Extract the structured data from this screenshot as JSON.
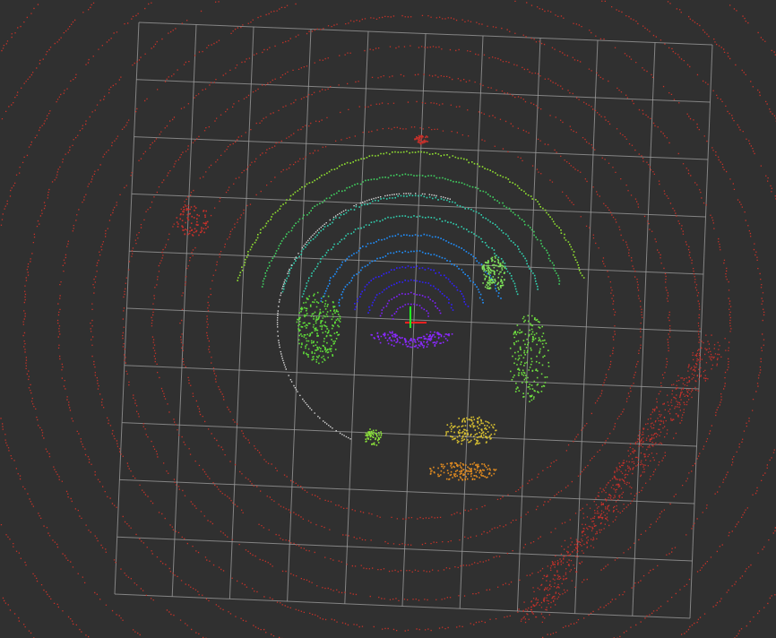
{
  "viewer": {
    "background_color": "#303030",
    "grid_color": "#a0a0a0",
    "grid_cells": 10,
    "axis_x_color": "#ff2020",
    "axis_y_color": "#20ff20",
    "far_point_color": "#c83228"
  },
  "point_cloud": {
    "color_map": "distance-rainbow",
    "near_colors": [
      "#8020ff",
      "#3020ff",
      "#2090ff",
      "#30d0b0",
      "#40d060",
      "#90e030",
      "#e0c020",
      "#e07020",
      "#c83228"
    ],
    "ring_count": 22,
    "obstacles": [
      {
        "id": "cluster-left-green",
        "color": "#5fdc3a"
      },
      {
        "id": "cluster-front-right-green",
        "color": "#7fe55a"
      },
      {
        "id": "cluster-right-green",
        "color": "#6fe040"
      },
      {
        "id": "cluster-bottom-yellow",
        "color": "#d8c030"
      },
      {
        "id": "cluster-bottom-orange",
        "color": "#e08a20"
      },
      {
        "id": "cluster-bottom-green",
        "color": "#8ae03a"
      },
      {
        "id": "wall-right-diagonal",
        "color": "#c8302a"
      },
      {
        "id": "cluster-top-red",
        "color": "#c8302a"
      },
      {
        "id": "cluster-left-red",
        "color": "#c8302a"
      }
    ]
  }
}
